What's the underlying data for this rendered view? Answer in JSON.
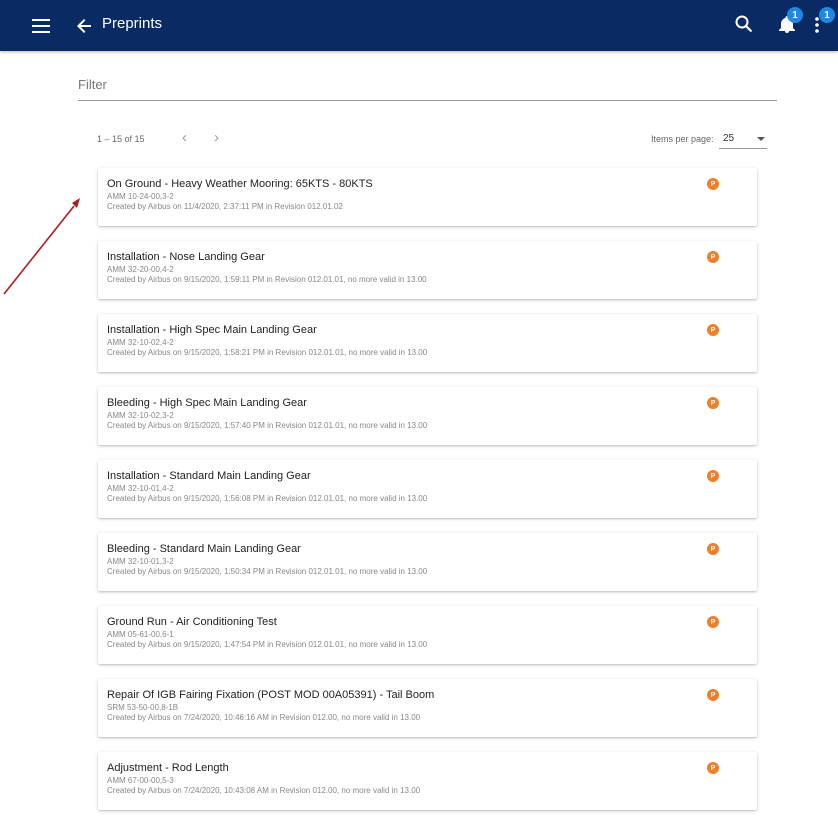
{
  "header": {
    "title": "Preprints",
    "notification_count": "1",
    "more_count": "1",
    "bar_color": "#0a2a63",
    "badge_color": "#1e88e5"
  },
  "filter": {
    "placeholder": "Filter",
    "value": ""
  },
  "pagination": {
    "range": "1 – 15 of 15",
    "items_per_page_label": "Items per page:",
    "items_per_page": "25"
  },
  "icons": {
    "menu": "menu-icon",
    "back": "arrow-left-icon",
    "search": "search-icon",
    "notifications": "bell-icon",
    "more": "more-vertical-icon",
    "prev": "chevron-left-icon",
    "next": "chevron-right-icon",
    "preprint_badge": "P"
  },
  "preprint_badge_color": "#f07e2a",
  "annotation_arrow_color": "#b01c1c",
  "items": [
    {
      "title": "On Ground - Heavy Weather Mooring: 65KTS - 80KTS",
      "ref": "AMM 10-24-00,3-2",
      "meta": "Created by Airbus on 11/4/2020, 2:37:11 PM in Revision 012.01.02",
      "badge": "P"
    },
    {
      "title": "Installation - Nose Landing Gear",
      "ref": "AMM 32-20-00,4-2",
      "meta": "Created by Airbus on 9/15/2020, 1:59:11 PM in Revision 012.01.01, no more valid in 13.00",
      "badge": "P"
    },
    {
      "title": "Installation - High Spec Main Landing Gear",
      "ref": "AMM 32-10-02,4-2",
      "meta": "Created by Airbus on 9/15/2020, 1:58:21 PM in Revision 012.01.01, no more valid in 13.00",
      "badge": "P"
    },
    {
      "title": "Bleeding - High Spec Main Landing Gear",
      "ref": "AMM 32-10-02,3-2",
      "meta": "Created by Airbus on 9/15/2020, 1:57:40 PM in Revision 012.01.01, no more valid in 13.00",
      "badge": "P"
    },
    {
      "title": "Installation - Standard Main Landing Gear",
      "ref": "AMM 32-10-01,4-2",
      "meta": "Created by Airbus on 9/15/2020, 1:56:08 PM in Revision 012.01.01, no more valid in 13.00",
      "badge": "P"
    },
    {
      "title": "Bleeding - Standard Main Landing Gear",
      "ref": "AMM 32-10-01,3-2",
      "meta": "Created by Airbus on 9/15/2020, 1:50:34 PM in Revision 012.01.01, no more valid in 13.00",
      "badge": "P"
    },
    {
      "title": "Ground Run - Air Conditioning Test",
      "ref": "AMM 05-61-00,6-1",
      "meta": "Created by Airbus on 9/15/2020, 1:47:54 PM in Revision 012.01.01, no more valid in 13.00",
      "badge": "P"
    },
    {
      "title": "Repair Of IGB Fairing Fixation (POST MOD 00A05391) - Tail Boom",
      "ref": "SRM 53-50-00,8-1B",
      "meta": "Created by Airbus on 7/24/2020, 10:46:16 AM in Revision 012.00, no more valid in 13.00",
      "badge": "P"
    },
    {
      "title": "Adjustment - Rod Length",
      "ref": "AMM 67-00-00,5-3",
      "meta": "Created by Airbus on 7/24/2020, 10:43:08 AM in Revision 012.00, no more valid in 13.00",
      "badge": "P"
    }
  ]
}
